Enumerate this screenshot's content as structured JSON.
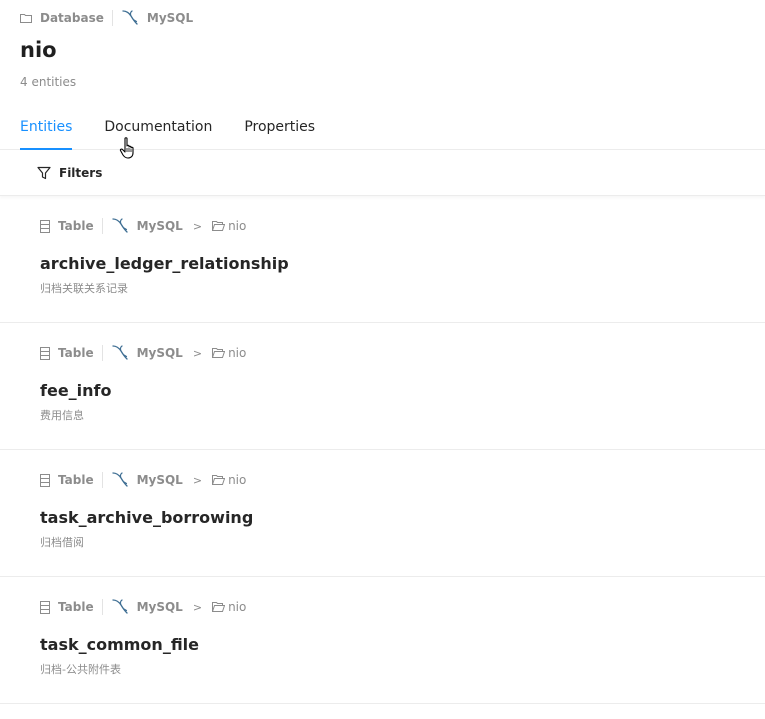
{
  "breadcrumb": {
    "platform": "Database",
    "source": "MySQL"
  },
  "header": {
    "title": "nio",
    "count": "4 entities"
  },
  "tabs": [
    {
      "label": "Entities",
      "active": true
    },
    {
      "label": "Documentation",
      "active": false
    },
    {
      "label": "Properties",
      "active": false
    }
  ],
  "filters": {
    "label": "Filters"
  },
  "entities": [
    {
      "type": "Table",
      "platform": "MySQL",
      "container": "nio",
      "name": "archive_ledger_relationship",
      "description": "归档关联关系记录"
    },
    {
      "type": "Table",
      "platform": "MySQL",
      "container": "nio",
      "name": "fee_info",
      "description": "费用信息"
    },
    {
      "type": "Table",
      "platform": "MySQL",
      "container": "nio",
      "name": "task_archive_borrowing",
      "description": "归档借阅"
    },
    {
      "type": "Table",
      "platform": "MySQL",
      "container": "nio",
      "name": "task_common_file",
      "description": "归档-公共附件表"
    }
  ],
  "colors": {
    "accent": "#1890ff",
    "muted": "#8c8c8c",
    "mysql_icon": "#3e6e93"
  }
}
